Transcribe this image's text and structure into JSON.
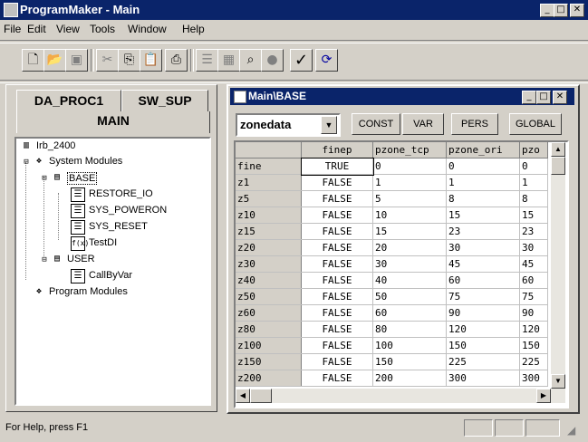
{
  "window": {
    "title": "ProgramMaker - Main"
  },
  "menu": [
    "File",
    "Edit",
    "View",
    "Tools",
    "Window",
    "Help"
  ],
  "toolbar_icons": [
    "new-icon",
    "open-icon",
    "save-icon",
    "cut-icon",
    "copy-icon",
    "paste-icon",
    "print-icon",
    "form-icon",
    "table-icon",
    "find-icon",
    "record-icon",
    "check-icon",
    "update-icon"
  ],
  "left": {
    "tabs": [
      "DA_PROC1",
      "SW_SUP"
    ],
    "main_label": "MAIN",
    "tree": [
      {
        "label": "Irb_2400",
        "level": 0,
        "icon": "robot-icon"
      },
      {
        "label": "System Modules",
        "level": 0,
        "icon": "modules-icon"
      },
      {
        "label": "BASE",
        "level": 1,
        "icon": "module-icon"
      },
      {
        "label": "RESTORE_IO",
        "level": 2,
        "icon": "routine-icon"
      },
      {
        "label": "SYS_POWERON",
        "level": 2,
        "icon": "routine-icon"
      },
      {
        "label": "SYS_RESET",
        "level": 2,
        "icon": "routine-icon"
      },
      {
        "label": "TestDI",
        "level": 2,
        "icon": "function-icon"
      },
      {
        "label": "USER",
        "level": 1,
        "icon": "module-icon"
      },
      {
        "label": "CallByVar",
        "level": 2,
        "icon": "routine-icon"
      },
      {
        "label": "Program Modules",
        "level": 0,
        "icon": "program-modules-icon"
      }
    ]
  },
  "datawin": {
    "title": "Main\\BASE",
    "type_select": "zonedata",
    "buttons": [
      "CONST",
      "VAR",
      "PERS",
      "GLOBAL"
    ],
    "columns": [
      "finep",
      "pzone_tcp",
      "pzone_ori",
      "pzo"
    ],
    "rows": [
      [
        "fine",
        "TRUE",
        "0",
        "0",
        "0"
      ],
      [
        "z1",
        "FALSE",
        "1",
        "1",
        "1"
      ],
      [
        "z5",
        "FALSE",
        "5",
        "8",
        "8"
      ],
      [
        "z10",
        "FALSE",
        "10",
        "15",
        "15"
      ],
      [
        "z15",
        "FALSE",
        "15",
        "23",
        "23"
      ],
      [
        "z20",
        "FALSE",
        "20",
        "30",
        "30"
      ],
      [
        "z30",
        "FALSE",
        "30",
        "45",
        "45"
      ],
      [
        "z40",
        "FALSE",
        "40",
        "60",
        "60"
      ],
      [
        "z50",
        "FALSE",
        "50",
        "75",
        "75"
      ],
      [
        "z60",
        "FALSE",
        "60",
        "90",
        "90"
      ],
      [
        "z80",
        "FALSE",
        "80",
        "120",
        "120"
      ],
      [
        "z100",
        "FALSE",
        "100",
        "150",
        "150"
      ],
      [
        "z150",
        "FALSE",
        "150",
        "225",
        "225"
      ],
      [
        "z200",
        "FALSE",
        "200",
        "300",
        "300"
      ]
    ]
  },
  "status": {
    "text": "For Help, press F1"
  }
}
